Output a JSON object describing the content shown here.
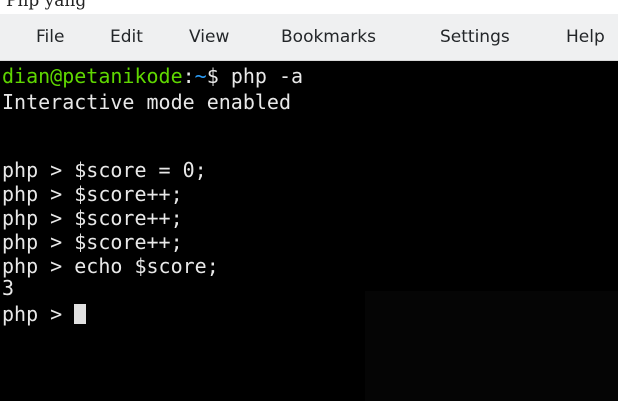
{
  "top_strip": {
    "text": "Php yang"
  },
  "menu": {
    "items": [
      {
        "label": "File"
      },
      {
        "label": "Edit"
      },
      {
        "label": "View"
      },
      {
        "label": "Bookmarks"
      },
      {
        "label": "Settings"
      },
      {
        "label": "Help"
      }
    ]
  },
  "terminal": {
    "prompt": {
      "user_host": "dian@petanikode",
      "colon": ":",
      "path": "~",
      "symbol": "$ ",
      "command": "php -a"
    },
    "lines": [
      "Interactive mode enabled",
      "",
      "php > $score = 0;",
      "php > $score++;",
      "php > $score++;",
      "php > $score++;",
      "php > echo $score;",
      "3"
    ],
    "last_prompt": "php > "
  },
  "colors": {
    "user_host": "#5fd700",
    "path": "#2b9bf4",
    "terminal_bg": "#000000",
    "terminal_fg": "#e8e8e8",
    "menubar_bg": "#eff0f1"
  }
}
